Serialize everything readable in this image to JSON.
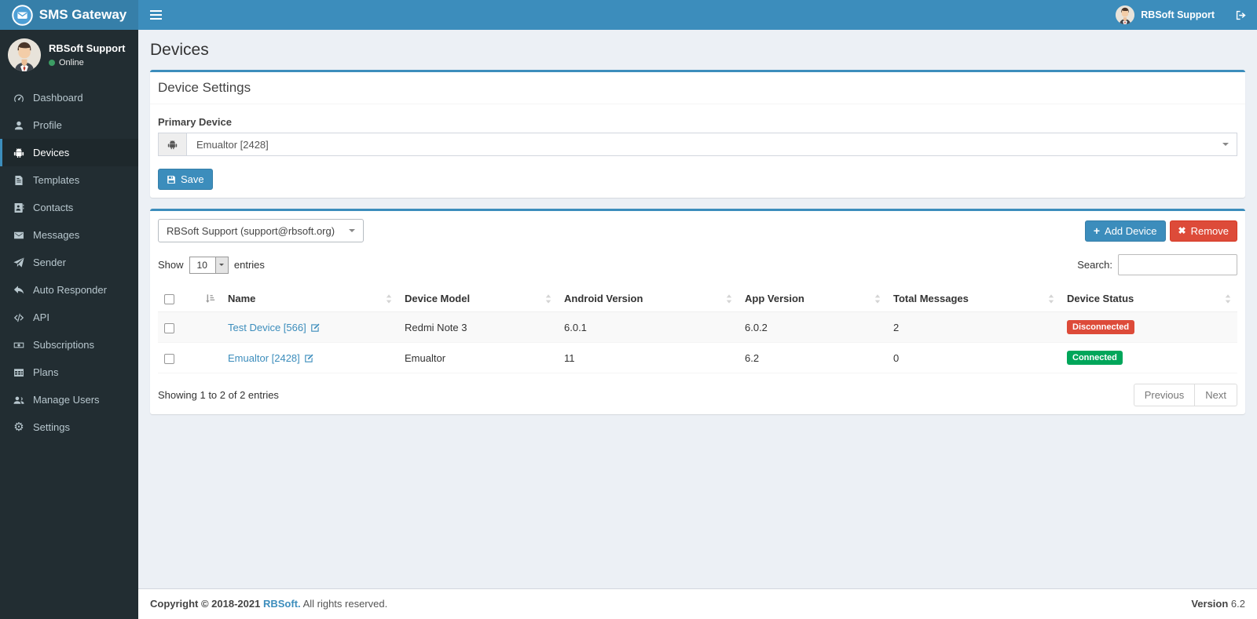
{
  "app": {
    "brand": "SMS Gateway"
  },
  "navbar": {
    "user_name": "RBSoft Support"
  },
  "sidebar": {
    "user_name": "RBSoft Support",
    "user_status": "Online",
    "items": [
      {
        "label": "Dashboard"
      },
      {
        "label": "Profile"
      },
      {
        "label": "Devices"
      },
      {
        "label": "Templates"
      },
      {
        "label": "Contacts"
      },
      {
        "label": "Messages"
      },
      {
        "label": "Sender"
      },
      {
        "label": "Auto Responder"
      },
      {
        "label": "API"
      },
      {
        "label": "Subscriptions"
      },
      {
        "label": "Plans"
      },
      {
        "label": "Manage Users"
      },
      {
        "label": "Settings"
      }
    ]
  },
  "page_title": "Devices",
  "settings_box": {
    "title": "Device Settings",
    "primary_device_label": "Primary Device",
    "primary_device_value": "Emualtor [2428]",
    "save_label": "Save"
  },
  "devices_box": {
    "user_filter_value": "RBSoft Support (support@rbsoft.org)",
    "add_button": "Add Device",
    "remove_button": "Remove",
    "show_label": "Show",
    "page_size": "10",
    "entries_label": "entries",
    "search_label": "Search:",
    "headers": {
      "name": "Name",
      "model": "Device Model",
      "android": "Android Version",
      "app": "App Version",
      "messages": "Total Messages",
      "status": "Device Status"
    },
    "rows": [
      {
        "name": "Test Device [566]",
        "model": "Redmi Note 3",
        "android": "6.0.1",
        "app": "6.0.2",
        "messages": "2",
        "status": "Disconnected",
        "status_style": "background:#dd4b39"
      },
      {
        "name": "Emualtor [2428]",
        "model": "Emualtor",
        "android": "11",
        "app": "6.2",
        "messages": "0",
        "status": "Connected",
        "status_style": "background:#00a65a"
      }
    ],
    "info": "Showing 1 to 2 of 2 entries",
    "prev": "Previous",
    "next": "Next"
  },
  "footer": {
    "copyright": "Copyright © 2018-2021",
    "brand": "RBSoft.",
    "rights": "All rights reserved.",
    "version_label": "Version",
    "version": "6.2"
  },
  "colors": {
    "navbar": "#3c8dbc",
    "logo_bg": "#367fa9",
    "sidebar": "#222d32",
    "sidebar_active": "#1e282c",
    "accent": "#3c8dbc",
    "danger": "#dd4b39",
    "success": "#00a65a",
    "content_bg": "#ecf0f5"
  }
}
